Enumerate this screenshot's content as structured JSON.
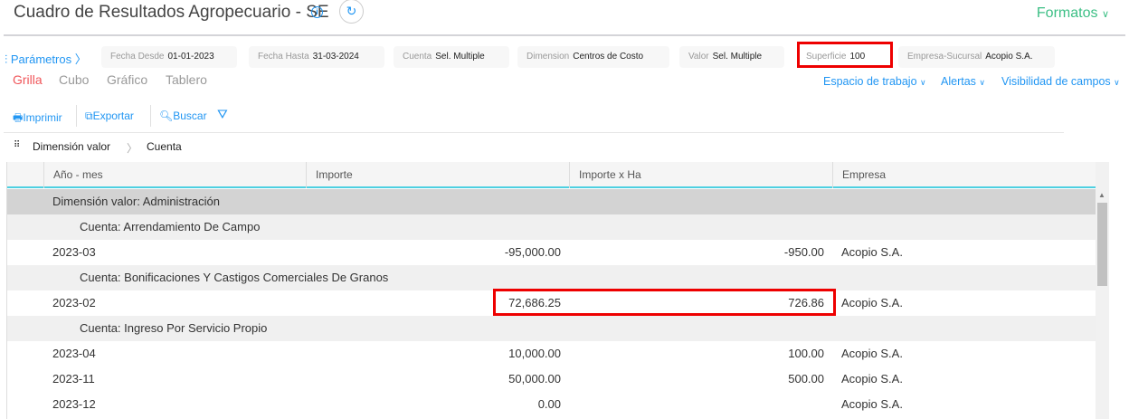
{
  "header": {
    "title": "Cuadro de Resultados Agropecuario - SE",
    "info_icon": "i",
    "refresh_icon": "↻",
    "formatos": "Formatos"
  },
  "params": {
    "label": "Parámetros",
    "chevron": "〉",
    "chips": [
      {
        "label": "Fecha Desde",
        "value": "01-01-2023"
      },
      {
        "label": "Fecha Hasta",
        "value": "31-03-2024"
      },
      {
        "label": "Cuenta",
        "value": "Sel. Multiple"
      },
      {
        "label": "Dimension",
        "value": "Centros de Costo"
      },
      {
        "label": "Valor",
        "value": "Sel. Multiple"
      },
      {
        "label": "Superficie",
        "value": "100"
      },
      {
        "label": "Empresa-Sucursal",
        "value": "Acopio S.A."
      }
    ]
  },
  "tabs": [
    "Grilla",
    "Cubo",
    "Gráfico",
    "Tablero"
  ],
  "right_links": [
    "Espacio de trabajo",
    "Alertas",
    "Visibilidad de campos"
  ],
  "toolbar": {
    "print": "Imprimir",
    "export": "Exportar",
    "search": "Buscar"
  },
  "breadcrumb": [
    "Dimensión valor",
    "Cuenta"
  ],
  "table": {
    "columns": [
      "Año - mes",
      "Importe",
      "Importe x Ha",
      "Empresa"
    ],
    "rows": [
      {
        "type": "g1",
        "label": "Dimensión valor: Administración"
      },
      {
        "type": "g2",
        "label": "Cuenta: Arrendamiento De Campo"
      },
      {
        "type": "data",
        "period": "2023-03",
        "importe": "-95,000.00",
        "por_ha": "-950.00",
        "empresa": "Acopio S.A."
      },
      {
        "type": "g2",
        "label": "Cuenta: Bonificaciones Y Castigos Comerciales De Granos"
      },
      {
        "type": "data",
        "period": "2023-02",
        "importe": "72,686.25",
        "por_ha": "726.86",
        "empresa": "Acopio S.A."
      },
      {
        "type": "g2",
        "label": "Cuenta: Ingreso Por Servicio Propio"
      },
      {
        "type": "data",
        "period": "2023-04",
        "importe": "10,000.00",
        "por_ha": "100.00",
        "empresa": "Acopio S.A."
      },
      {
        "type": "data",
        "period": "2023-11",
        "importe": "50,000.00",
        "por_ha": "500.00",
        "empresa": "Acopio S.A."
      },
      {
        "type": "data",
        "period": "2023-12",
        "importe": "0.00",
        "por_ha": "",
        "empresa": "Acopio S.A."
      }
    ]
  }
}
